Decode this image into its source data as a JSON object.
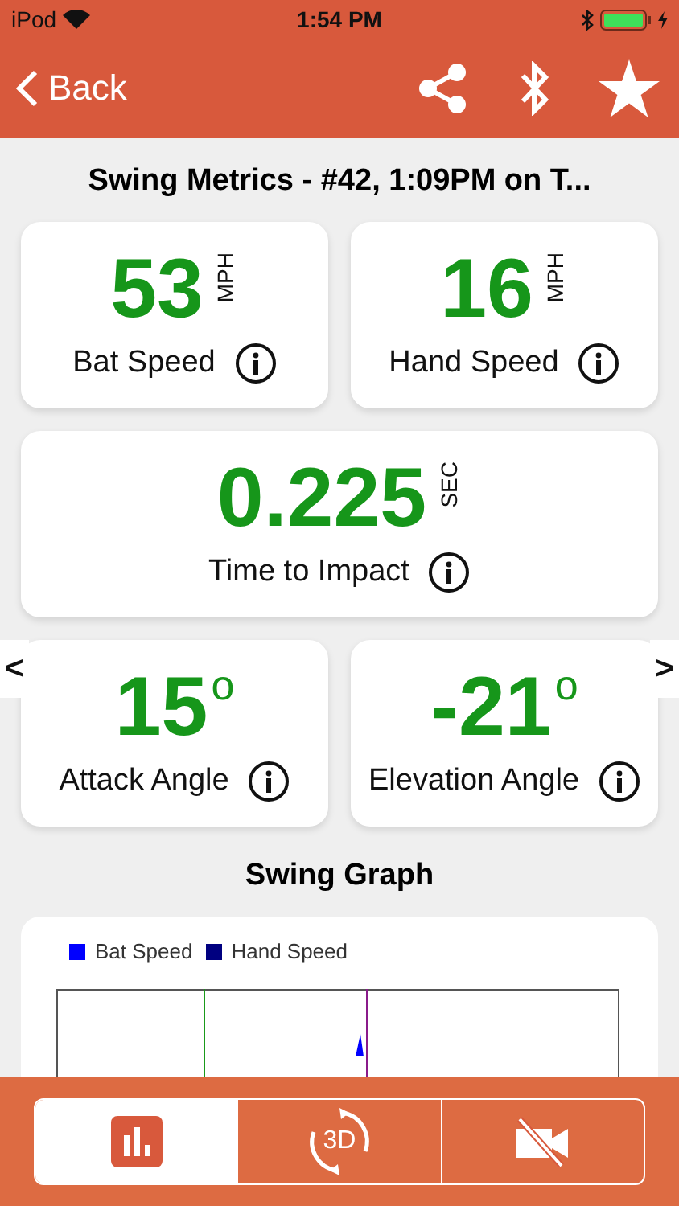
{
  "status_bar": {
    "carrier": "iPod",
    "time": "1:54 PM"
  },
  "nav": {
    "back": "Back"
  },
  "title": "Swing Metrics - #42, 1:09PM on T...",
  "metric_rows": [
    [
      {
        "value": "53",
        "unit": "MPH",
        "kind": "vertical",
        "label": "Bat Speed"
      },
      {
        "value": "16",
        "unit": "MPH",
        "kind": "vertical",
        "label": "Hand Speed"
      }
    ],
    [
      {
        "value": "0.225",
        "unit": "SEC",
        "kind": "vertical",
        "label": "Time to Impact"
      }
    ],
    [
      {
        "value": "15",
        "unit": "o",
        "kind": "superscript",
        "label": "Attack Angle"
      },
      {
        "value": "-21",
        "unit": "o",
        "kind": "superscript",
        "label": "Elevation Angle"
      }
    ]
  ],
  "pager": {
    "prev": "<",
    "next": ">"
  },
  "graph": {
    "title": "Swing Graph",
    "legend": [
      {
        "label": "Bat Speed",
        "color": "#0000ff"
      },
      {
        "label": "Hand Speed",
        "color": "#000080"
      }
    ]
  },
  "bottom_tabs": [
    {
      "kind": "chart",
      "selected": true
    },
    {
      "kind": "rotate3d",
      "text": "3D",
      "selected": false
    },
    {
      "kind": "video_off",
      "selected": false
    }
  ]
}
